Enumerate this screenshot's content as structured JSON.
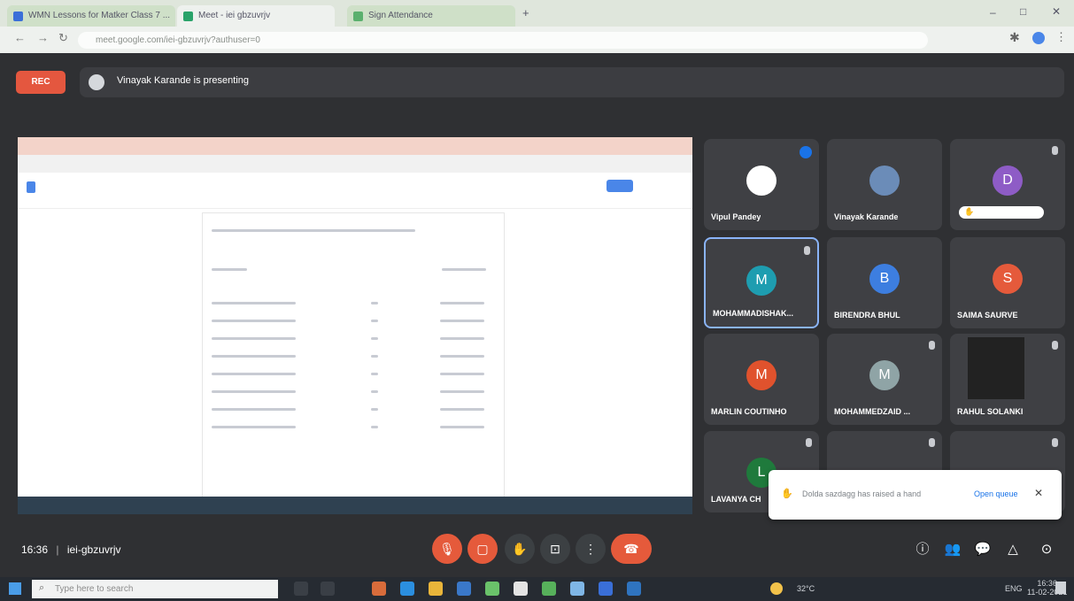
{
  "browser": {
    "tabs": [
      {
        "label": "WMN Lessons for Matker Class 7 ..."
      },
      {
        "label": "Meet - iei gbzuvrjv"
      },
      {
        "label": "Sign Attendance"
      }
    ],
    "url": "meet.google.com/iei-gbzuvrjv?authuser=0"
  },
  "meet": {
    "rec_label": "REC",
    "presenting_text": "Vinayak Karande is presenting",
    "meeting_time": "16:36",
    "meeting_code": "iei-gbzuvrjv"
  },
  "participants": [
    {
      "name": "Vipul Pandey",
      "initial": "",
      "color": "#ffffff"
    },
    {
      "name": "Vinayak Karande",
      "initial": "",
      "color": "#6b8cb8"
    },
    {
      "name": "",
      "initial": "D",
      "color": "#8e5cc6"
    },
    {
      "name": "MOHAMMADISHAK...",
      "initial": "M",
      "color": "#1e9db0"
    },
    {
      "name": "BIRENDRA BHUL",
      "initial": "B",
      "color": "#3d7ee0"
    },
    {
      "name": "SAIMA SAURVE",
      "initial": "S",
      "color": "#e55a3b"
    },
    {
      "name": "MARLIN COUTINHO",
      "initial": "M",
      "color": "#e0522d"
    },
    {
      "name": "MOHAMMEDZAID ...",
      "initial": "M",
      "color": "#8fa4a6"
    },
    {
      "name": "RAHUL SOLANKI",
      "initial": "",
      "color": "#222222"
    },
    {
      "name": "LAVANYA CH",
      "initial": "L",
      "color": "#1f7a3c"
    }
  ],
  "toast": {
    "message": "Dolda sazdagg has raised a hand",
    "action": "Open queue"
  },
  "taskbar": {
    "search_placeholder": "Type here to search",
    "temperature": "32°C",
    "lang": "ENG",
    "time": "16:36",
    "date": "11-02-2021"
  }
}
